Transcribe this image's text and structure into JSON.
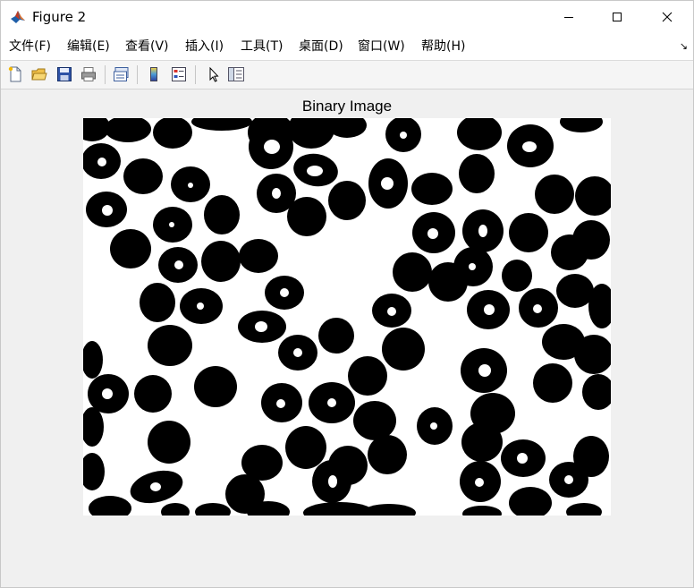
{
  "window": {
    "title": "Figure 2",
    "icon": "matlab-icon",
    "controls": [
      "minimize-icon",
      "maximize-icon",
      "close-icon"
    ]
  },
  "menubar": {
    "items": [
      {
        "label": "文件(F)"
      },
      {
        "label": "编辑(E)"
      },
      {
        "label": "查看(V)"
      },
      {
        "label": "插入(I)"
      },
      {
        "label": "工具(T)"
      },
      {
        "label": "桌面(D)"
      },
      {
        "label": "窗口(W)"
      },
      {
        "label": "帮助(H)"
      }
    ],
    "dock_icon": "dock-arrow-icon"
  },
  "toolbar": {
    "buttons": [
      "new-figure-icon",
      "open-file-icon",
      "save-icon",
      "print-icon",
      "link-plot-icon",
      "insert-colorbar-icon",
      "insert-legend-icon",
      "edit-plot-icon",
      "property-inspector-icon"
    ]
  },
  "axes": {
    "title": "Binary Image",
    "colors": {
      "foreground": "#000000",
      "background": "#ffffff"
    }
  }
}
